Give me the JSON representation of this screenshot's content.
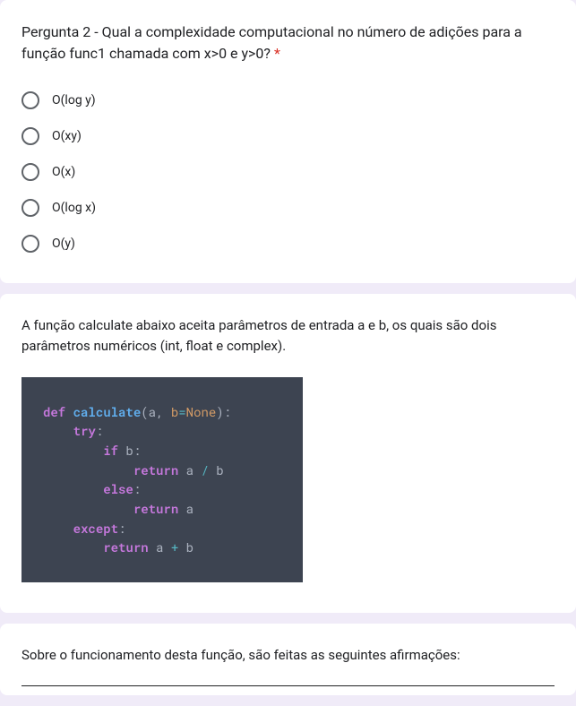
{
  "q2": {
    "prompt_prefix": "Pergunta 2 - Qual a complexidade computacional no número de adições para a função func1 chamada com x>0 e y>0? ",
    "required_mark": "*",
    "options": [
      "O(log y)",
      "O(xy)",
      "O(x)",
      "O(log x)",
      "O(y)"
    ]
  },
  "q3": {
    "intro": "A função calculate abaixo aceita parâmetros de entrada a e b, os quais são dois parâmetros numéricos (int, float e complex).",
    "code": {
      "kw_def": "def",
      "fn_name": "calculate",
      "params_open": "(a, ",
      "kwarg_b": "b",
      "eq": "=",
      "none": "None",
      "params_close": "):",
      "kw_try": "try",
      "colon1": ":",
      "kw_if": "if",
      "if_cond": " b:",
      "kw_return1": "return",
      "ret1_a": " a ",
      "op_div": "/",
      "ret1_b": " b",
      "kw_else": "else",
      "colon2": ":",
      "kw_return2": "return",
      "ret2": " a",
      "kw_except": "except",
      "colon3": ":",
      "kw_return3": "return",
      "ret3_a": " a ",
      "op_plus": "+",
      "ret3_b": " b"
    }
  },
  "q4": {
    "intro": "Sobre o funcionamento desta função, são feitas as seguintes afirmações:"
  }
}
